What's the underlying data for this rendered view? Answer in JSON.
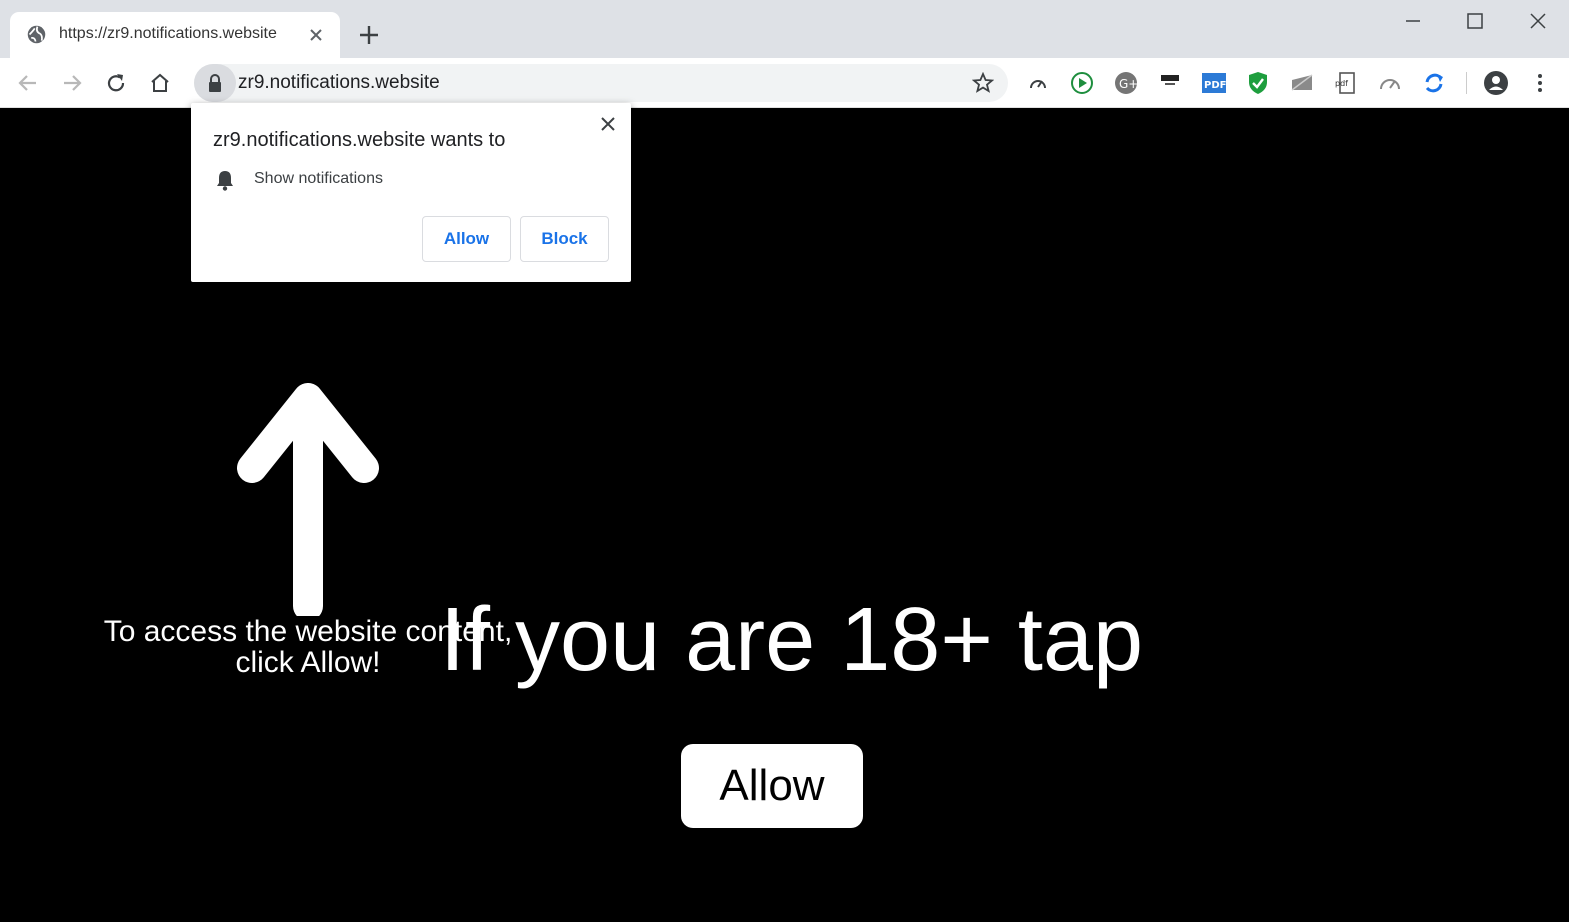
{
  "browser": {
    "tab": {
      "title": "https://zr9.notifications.website"
    },
    "omnibox": {
      "url": "zr9.notifications.website"
    }
  },
  "popup": {
    "title": "zr9.notifications.website wants to",
    "permission": "Show notifications",
    "allow_label": "Allow",
    "block_label": "Block"
  },
  "page": {
    "access_line1": "To access the website content,",
    "access_line2": "click Allow!",
    "headline": "If you are 18+ tap",
    "allow_label": "Allow"
  },
  "colors": {
    "link_blue": "#1a73e8",
    "page_bg": "#000000",
    "tab_bg": "#dee1e6"
  }
}
